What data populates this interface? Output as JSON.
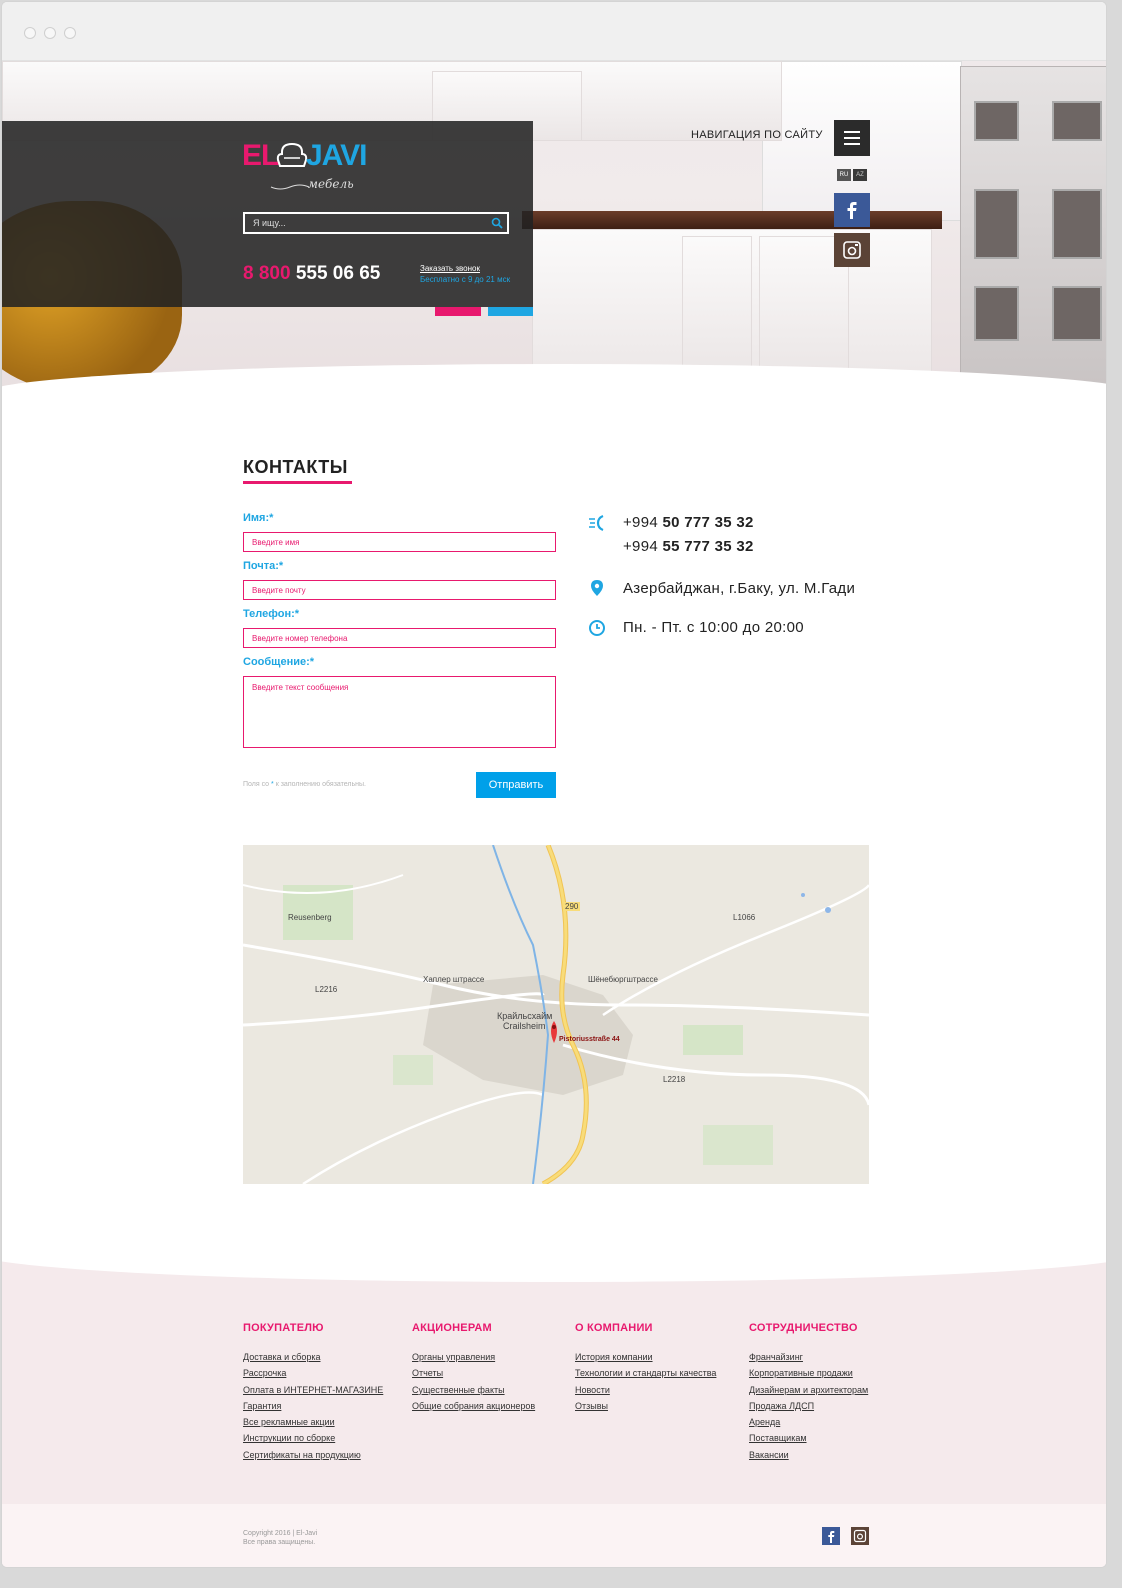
{
  "header": {
    "brand": {
      "part1": "EL",
      "part2": "JAVI",
      "tagline": "мебель"
    },
    "search": {
      "placeholder": "Я ищу..."
    },
    "phone": {
      "prefix": "8 800",
      "number": "555 06 65"
    },
    "callback_link": "Заказать звонок",
    "callback_hours": "Бесплатно с 9 до 21 мск",
    "nav_label": "НАВИГАЦИЯ ПО САЙТУ",
    "languages": [
      "RU",
      "AZ"
    ],
    "active_language": "RU",
    "social": [
      "facebook-icon",
      "instagram-icon"
    ]
  },
  "contacts": {
    "title": "КОНТАКТЫ",
    "form": {
      "name_label": "Имя:",
      "name_placeholder": "Введите имя",
      "email_label": "Почта:",
      "email_placeholder": "Введите почту",
      "phone_label": "Телефон:",
      "phone_placeholder": "Введите номер телефона",
      "message_label": "Сообщение:",
      "message_placeholder": "Введите текст сообщения",
      "required_mark": "*",
      "required_note_before": "Поля со",
      "required_note_after": "к заполнению обязательны.",
      "submit": "Отправить"
    },
    "info": {
      "phone1_prefix": "+994",
      "phone1": "50 777 35 32",
      "phone2_prefix": "+994",
      "phone2": "55 777 35 32",
      "address": "Азербайджан, г.Баку, ул. М.Гади",
      "hours": "Пн. - Пт. с 10:00 до 20:00"
    }
  },
  "map": {
    "city_ru": "Крайльсхайм",
    "city": "Crailsheim",
    "pin_label": "Pistoriusstraße 44",
    "labels": [
      "Reusenberg",
      "Хаплер штрассе",
      "Шёнебюргштрассе",
      "L2218",
      "L1066",
      "L2216",
      "290"
    ]
  },
  "footer": {
    "columns": [
      {
        "title": "ПОКУПАТЕЛЮ",
        "links": [
          "Доставка и сборка",
          "Рассрочка",
          "Оплата в ИНТЕРНЕТ-МАГАЗИНЕ",
          "Гарантия",
          "Все рекламные акции",
          "Инструкции по сборке",
          "Сертификаты на продукцию"
        ]
      },
      {
        "title": "АКЦИОНЕРАМ",
        "links": [
          "Органы управления",
          "Отчеты",
          "Существенные факты",
          "Общие собрания акционеров"
        ]
      },
      {
        "title": "О КОМПАНИИ",
        "links": [
          "История компании",
          "Технологии и стандарты качества",
          "Новости",
          "Отзывы"
        ]
      },
      {
        "title": "СОТРУДНИЧЕСТВО",
        "links": [
          "Франчайзинг",
          "Корпоративные продажи",
          "Дизайнерам и архитекторам",
          "Продажа ЛДСП",
          "Аренда",
          "Поставщикам",
          "Вакансии"
        ]
      }
    ],
    "copyright": "Copyright 2016 | El-Javi",
    "rights": "Все права защищены."
  },
  "colors": {
    "pink": "#e8196e",
    "blue": "#1fa6e2",
    "button": "#00a0e9"
  }
}
